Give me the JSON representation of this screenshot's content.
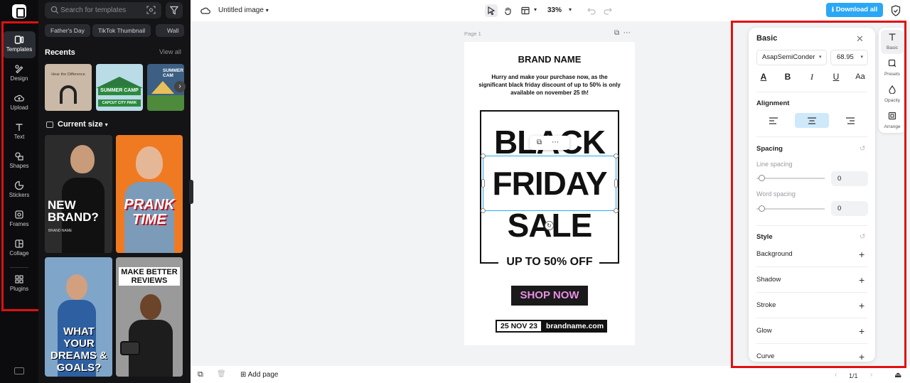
{
  "rail": {
    "items": [
      {
        "label": "Templates",
        "icon": "templates-icon"
      },
      {
        "label": "Design",
        "icon": "design-icon"
      },
      {
        "label": "Upload",
        "icon": "upload-icon"
      },
      {
        "label": "Text",
        "icon": "text-icon"
      },
      {
        "label": "Shapes",
        "icon": "shapes-icon"
      },
      {
        "label": "Stickers",
        "icon": "stickers-icon"
      },
      {
        "label": "Frames",
        "icon": "frames-icon"
      },
      {
        "label": "Collage",
        "icon": "collage-icon"
      },
      {
        "label": "Plugins",
        "icon": "plugins-icon"
      }
    ],
    "active": "Templates"
  },
  "templates": {
    "search_placeholder": "Search for templates",
    "chips": [
      "Father's Day",
      "TikTok Thumbnail",
      "Wall"
    ],
    "recents_title": "Recents",
    "view_all": "View all",
    "recent_thumbs": [
      {
        "text": "Hear the Difference"
      },
      {
        "text": "SUMMER CAMP",
        "sub": "CAPCUT CITY PARK"
      },
      {
        "text": "SUMMER CAM"
      }
    ],
    "size_title": "Current size",
    "grid": [
      {
        "text": "NEW BRAND?",
        "sub": "BRAND NAME"
      },
      {
        "text": "PRANK TIME"
      },
      {
        "text": "WHAT YOUR DREAMS & GOALS?"
      },
      {
        "text": "MAKE BETTER REVIEWS"
      }
    ]
  },
  "topbar": {
    "title": "Untitled image",
    "zoom": "33%",
    "download": "Download all"
  },
  "canvas": {
    "page_label": "Page 1",
    "brand": "BRAND NAME",
    "promo": "Hurry and make your purchase now, as the significant black friday discount of up to 50% is only available on november 25 th!",
    "line1": "BLACK",
    "line2": "FRIDAY",
    "line3": "SALE",
    "offer": "UP TO 50% OFF",
    "shop": "SHOP NOW",
    "date": "25 NOV 23",
    "site": "brandname.com"
  },
  "bottombar": {
    "add_page": "Add page",
    "page_count": "1/1"
  },
  "props": {
    "title": "Basic",
    "font": "AsapSemiConder",
    "size": "68.95",
    "alignment_title": "Alignment",
    "alignment_active": "center",
    "spacing_title": "Spacing",
    "line_spacing_label": "Line spacing",
    "line_spacing": "0",
    "word_spacing_label": "Word spacing",
    "word_spacing": "0",
    "style_title": "Style",
    "style_rows": [
      "Background",
      "Shadow",
      "Stroke",
      "Glow",
      "Curve"
    ]
  },
  "side_tabs": [
    "Basic",
    "Presets",
    "Opacity",
    "Arrange"
  ],
  "colors": {
    "accent": "#2aa7f5",
    "highlight": "#e01010",
    "shop_text": "#e58fe3",
    "dark_panel": "#141416"
  }
}
